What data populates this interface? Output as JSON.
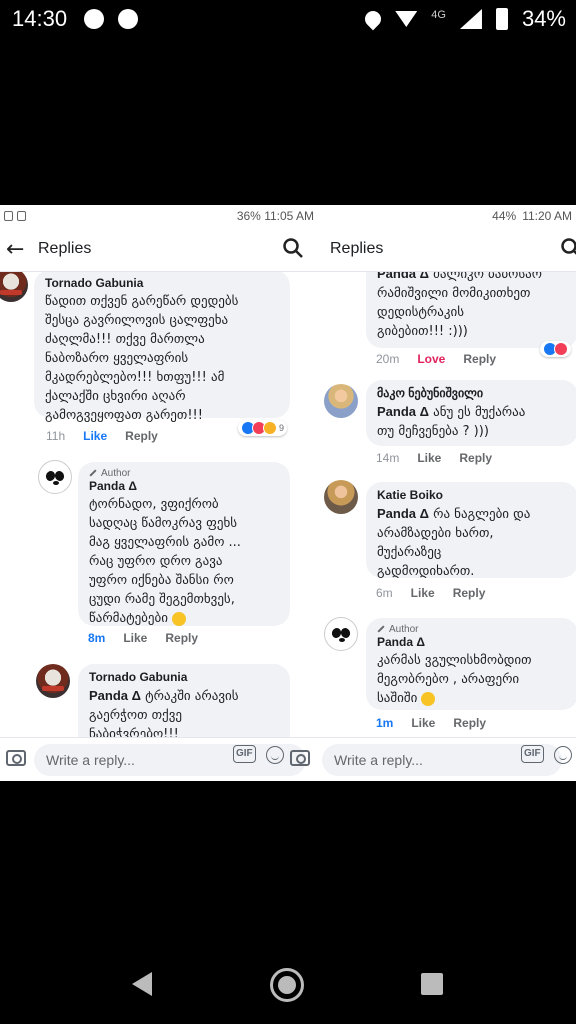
{
  "phone_status": {
    "time": "14:30",
    "network": "4G",
    "battery": "34%"
  },
  "left": {
    "status": {
      "battery": "36%",
      "time": "11:05 AM"
    },
    "header": {
      "title": "Replies"
    },
    "comments": [
      {
        "name": "Tornado Gabunia",
        "text": "წადით თქვენ გარეწარ დედებს\nშესცა გავრილოვის ცალფეხა\nძაღლმა!!! თქვე მართლა\nნაბოზარო ყველაფრის\nმკადრებლებო!!! ხთფუ!!! ამ\nქალაქში ცხვირი აღარ\nგამოგვეყოფათ გარეთ!!!",
        "time": "11h",
        "like": "Like",
        "reply": "Reply",
        "react_count": "9"
      },
      {
        "name": "Panda Δ",
        "author_badge": "Author",
        "text": "ტორნადო, ვფიქრობ\nსადღაც წამოკრავ ფეხს\nმაგ ყველაფრის გამო ...\nრაც უფრო დრო გავა\nუფრო იქნება შანსი რო\nცუდი რამე შეგემთხვეს,\nწარმატებები",
        "time": "8m",
        "like": "Like",
        "reply": "Reply"
      },
      {
        "name": "Tornado Gabunia",
        "mention": "Panda Δ",
        "text": " ტრაკში არავის\nგაერჭოთ თქვე\nნაბიჭვრებო!!!"
      }
    ],
    "composer": {
      "placeholder": "Write a reply...",
      "gif": "GIF"
    }
  },
  "right": {
    "status": {
      "battery": "44%",
      "time": "11:20 AM"
    },
    "header": {
      "title": "Replies"
    },
    "comments": [
      {
        "mention": "Panda Δ",
        "text": " ძალიკო ბაბოსაო\nრამიშვილი მომიკითხეთ\nდედისტრაკის\nგიბებით!!! :)))",
        "time": "20m",
        "love": "Love",
        "reply": "Reply"
      },
      {
        "name": "მაკო ნებუნიშვილი",
        "mention": "Panda Δ",
        "text": " ანუ ეს მუქარაა\nთუ მეჩვენება ? )))",
        "time": "14m",
        "like": "Like",
        "reply": "Reply"
      },
      {
        "name": "Katie Boiko",
        "mention": "Panda Δ",
        "text": " რა ნაგლები და\nარამზადები ხართ,\nმუქარაზეც\nგადმოდიხართ.",
        "time": "6m",
        "like": "Like",
        "reply": "Reply"
      },
      {
        "name": "Panda Δ",
        "author_badge": "Author",
        "text": "კარმას ვგულისხმობდით\nმეგობრებო , არაფერი\nსაშიში",
        "time": "1m",
        "like": "Like",
        "reply": "Reply"
      }
    ],
    "composer": {
      "placeholder": "Write a reply...",
      "gif": "GIF"
    }
  }
}
